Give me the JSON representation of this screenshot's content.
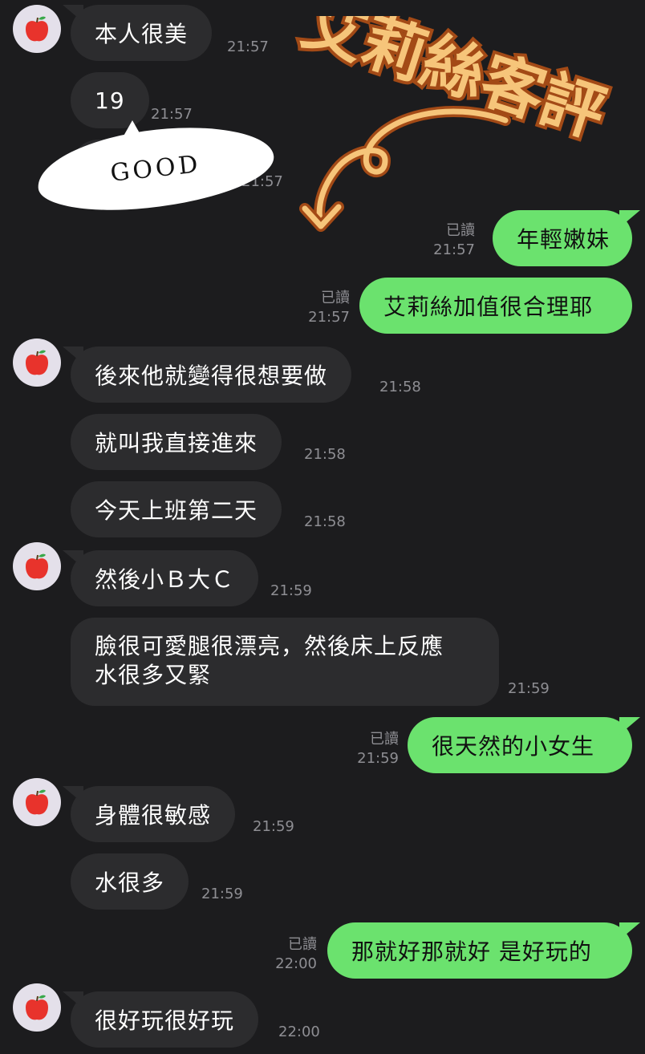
{
  "overlay": {
    "title": "艾莉絲客評"
  },
  "sticker": {
    "text": "GOOD"
  },
  "messages": [
    {
      "text": "本人很美",
      "time": "21:57"
    },
    {
      "text": "19",
      "time": "21:57"
    },
    {
      "time": "21:57"
    },
    {
      "text": "年輕嫩妹",
      "read": "已讀",
      "time": "21:57"
    },
    {
      "text": "艾莉絲加值很合理耶",
      "read": "已讀",
      "time": "21:57"
    },
    {
      "text": "後來他就變得很想要做",
      "time": "21:58"
    },
    {
      "text": "就叫我直接進來",
      "time": "21:58"
    },
    {
      "text": "今天上班第二天",
      "time": "21:58"
    },
    {
      "text": "然後小Ｂ大Ｃ",
      "time": "21:59"
    },
    {
      "text_line1": "臉很可愛腿很漂亮，然後床上反應",
      "text_line2": "水很多又緊",
      "time": "21:59"
    },
    {
      "text": "很天然的小女生",
      "read": "已讀",
      "time": "21:59"
    },
    {
      "text": "身體很敏感",
      "time": "21:59"
    },
    {
      "text": "水很多",
      "time": "21:59"
    },
    {
      "text": "那就好那就好 是好玩的",
      "read": "已讀",
      "time": "22:00"
    },
    {
      "text": "很好玩很好玩",
      "time": "22:00"
    }
  ],
  "colors": {
    "background": "#1c1c1e",
    "incoming_bubble": "#2c2c2e",
    "outgoing_bubble": "#6be26e",
    "timestamp": "#8e8e93",
    "overlay_fill": "#f6c57a",
    "overlay_outline": "#a34a16"
  },
  "icons": {
    "avatar": "red-apple-icon"
  }
}
